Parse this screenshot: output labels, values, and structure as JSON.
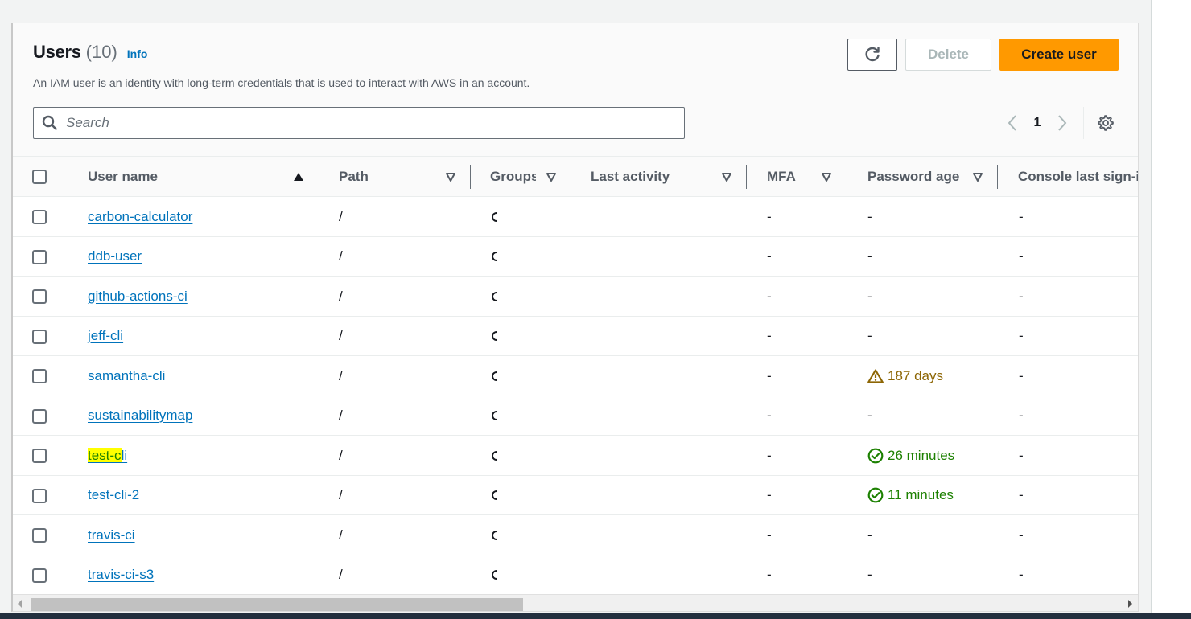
{
  "header": {
    "title": "Users",
    "count": "(10)",
    "info_label": "Info",
    "description": "An IAM user is an identity with long-term credentials that is used to interact with AWS in an account."
  },
  "actions": {
    "refresh_icon": "refresh-icon",
    "delete_label": "Delete",
    "create_label": "Create user"
  },
  "search": {
    "placeholder": "Search",
    "value": ""
  },
  "pagination": {
    "current_page": "1",
    "prev_icon": "chevron-left-icon",
    "next_icon": "chevron-right-icon",
    "settings_icon": "gear-icon"
  },
  "table": {
    "columns": [
      {
        "label": "User name",
        "sort": "ascending"
      },
      {
        "label": "Path",
        "sort": "none"
      },
      {
        "label": "Groups",
        "sort": "none"
      },
      {
        "label": "Last activity",
        "sort": "none"
      },
      {
        "label": "MFA",
        "sort": "none"
      },
      {
        "label": "Password age",
        "sort": "none"
      },
      {
        "label": "Console last sign-in",
        "sort": "none"
      }
    ],
    "rows": [
      {
        "user_name": "carbon-calculator",
        "path": "/",
        "groups": "loading",
        "last_activity": "",
        "mfa": "-",
        "password_age": "-",
        "password_status": "none",
        "console_last_signin": "-"
      },
      {
        "user_name": "ddb-user",
        "path": "/",
        "groups": "loading",
        "last_activity": "",
        "mfa": "-",
        "password_age": "-",
        "password_status": "none",
        "console_last_signin": "-"
      },
      {
        "user_name": "github-actions-ci",
        "path": "/",
        "groups": "loading",
        "last_activity": "",
        "mfa": "-",
        "password_age": "-",
        "password_status": "none",
        "console_last_signin": "-"
      },
      {
        "user_name": "jeff-cli",
        "path": "/",
        "groups": "loading",
        "last_activity": "",
        "mfa": "-",
        "password_age": "-",
        "password_status": "none",
        "console_last_signin": "-"
      },
      {
        "user_name": "samantha-cli",
        "path": "/",
        "groups": "loading",
        "last_activity": "",
        "mfa": "-",
        "password_age": "187 days",
        "password_status": "warning",
        "console_last_signin": "-"
      },
      {
        "user_name": "sustainabilitymap",
        "path": "/",
        "groups": "loading",
        "last_activity": "",
        "mfa": "-",
        "password_age": "-",
        "password_status": "none",
        "console_last_signin": "-"
      },
      {
        "user_name": "test-cli",
        "highlight": "test-c",
        "path": "/",
        "groups": "loading",
        "last_activity": "",
        "mfa": "-",
        "password_age": "26 minutes",
        "password_status": "success",
        "console_last_signin": "-"
      },
      {
        "user_name": "test-cli-2",
        "path": "/",
        "groups": "loading",
        "last_activity": "",
        "mfa": "-",
        "password_age": "11 minutes",
        "password_status": "success",
        "console_last_signin": "-"
      },
      {
        "user_name": "travis-ci",
        "path": "/",
        "groups": "loading",
        "last_activity": "",
        "mfa": "-",
        "password_age": "-",
        "password_status": "none",
        "console_last_signin": "-"
      },
      {
        "user_name": "travis-ci-s3",
        "path": "/",
        "groups": "loading",
        "last_activity": "",
        "mfa": "-",
        "password_age": "-",
        "password_status": "none",
        "console_last_signin": "-"
      }
    ]
  },
  "colors": {
    "primary": "#ff9900",
    "link": "#0073bb",
    "warning": "#8d6605",
    "success": "#1d8102",
    "highlight": "#ffff00"
  }
}
